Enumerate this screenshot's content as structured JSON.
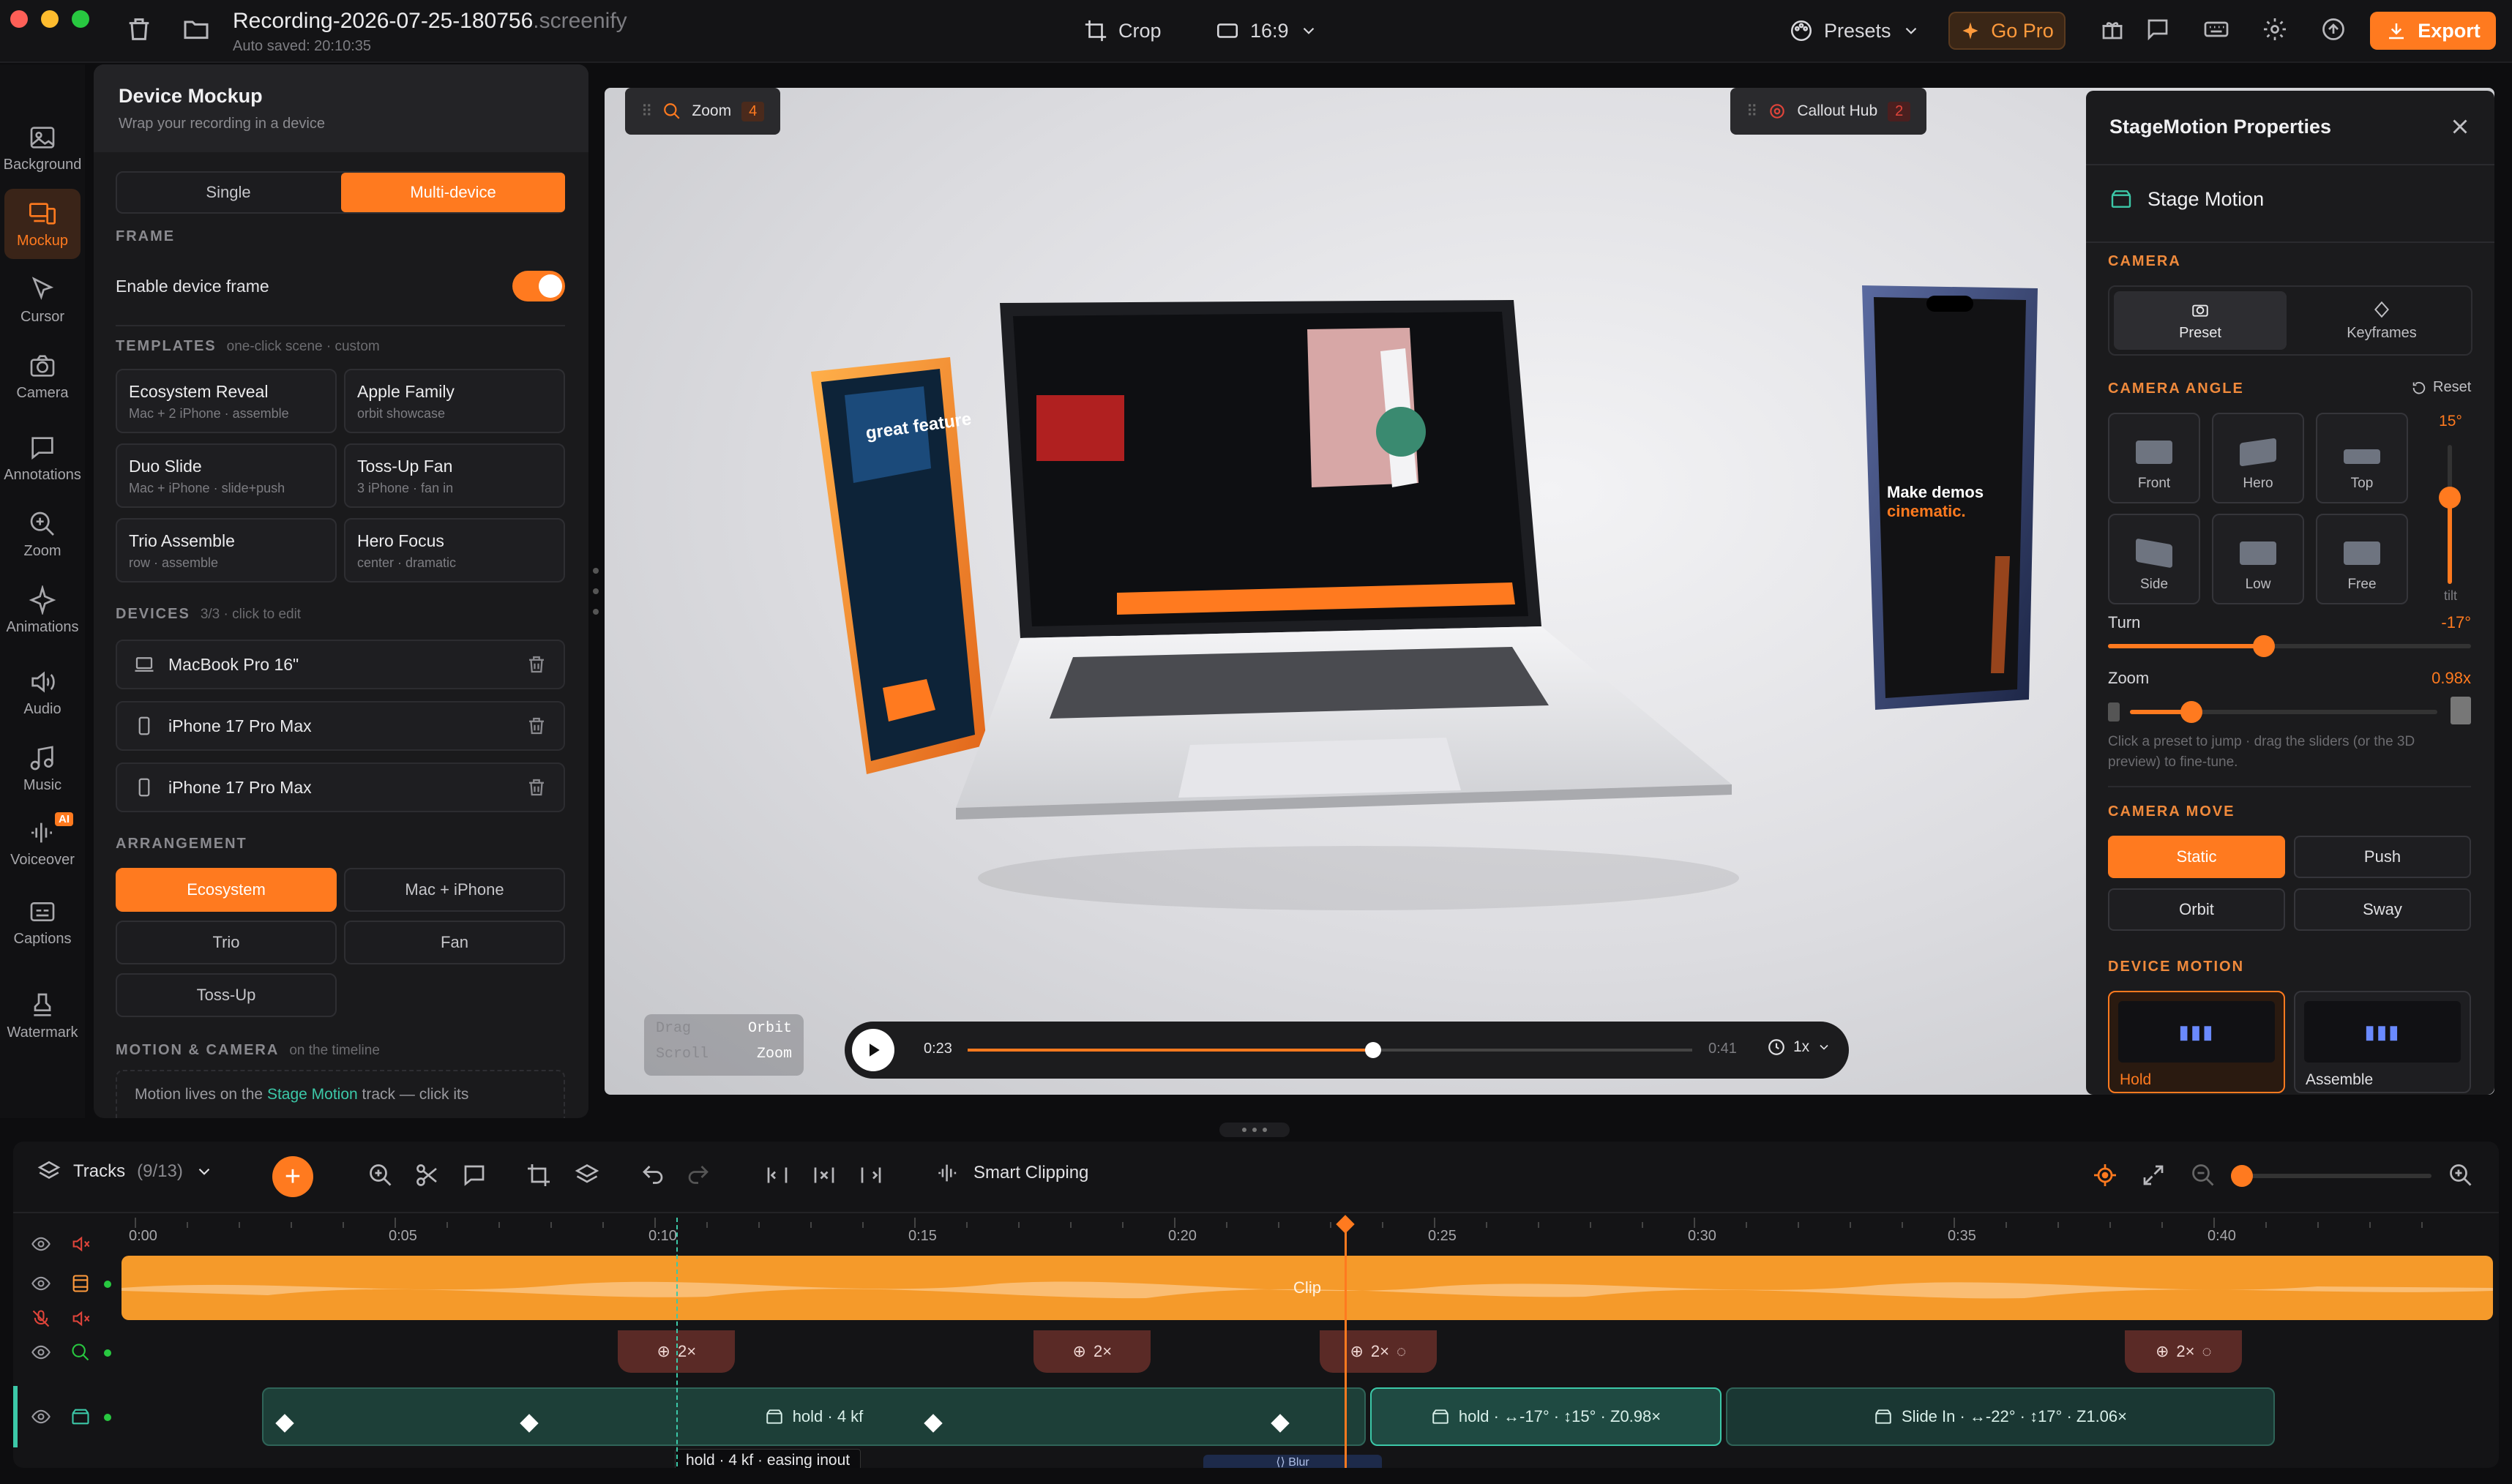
{
  "titlebar": {
    "file_name": "Recording-2026-07-25-180756",
    "file_ext": ".screenify",
    "autosave": "Auto saved: 20:10:35",
    "crop_label": "Crop",
    "ratio_label": "16:9",
    "presets_label": "Presets",
    "gopro_label": "Go Pro",
    "export_label": "Export"
  },
  "rail": [
    {
      "label": "Background",
      "icon": "image-icon"
    },
    {
      "label": "Mockup",
      "icon": "devices-icon",
      "active": true
    },
    {
      "label": "Cursor",
      "icon": "cursor-icon"
    },
    {
      "label": "Camera",
      "icon": "camera-icon"
    },
    {
      "label": "Annotations",
      "icon": "comment-icon"
    },
    {
      "label": "Zoom",
      "icon": "zoom-icon"
    },
    {
      "label": "Animations",
      "icon": "sparkle-icon"
    },
    {
      "label": "Audio",
      "icon": "speaker-icon"
    },
    {
      "label": "Music",
      "icon": "music-icon"
    },
    {
      "label": "Voiceover",
      "icon": "waveform-icon",
      "badge": "AI"
    },
    {
      "label": "Captions",
      "icon": "captions-icon"
    },
    {
      "label": "Watermark",
      "icon": "stamp-icon"
    }
  ],
  "panel": {
    "title": "Device Mockup",
    "subtitle": "Wrap your recording in a device",
    "mode_single": "Single",
    "mode_multi": "Multi-device",
    "frame_section": "FRAME",
    "enable_frame": "Enable device frame",
    "templates_section": "TEMPLATES",
    "templates_hint": "one-click scene · custom",
    "templates": [
      {
        "title": "Ecosystem Reveal",
        "sub": "Mac + 2 iPhone · assemble"
      },
      {
        "title": "Apple Family",
        "sub": "orbit showcase"
      },
      {
        "title": "Duo Slide",
        "sub": "Mac + iPhone · slide+push"
      },
      {
        "title": "Toss-Up Fan",
        "sub": "3 iPhone · fan in"
      },
      {
        "title": "Trio Assemble",
        "sub": "row · assemble"
      },
      {
        "title": "Hero Focus",
        "sub": "center · dramatic"
      }
    ],
    "devices_section": "DEVICES",
    "devices_hint": "3/3 · click to edit",
    "devices": [
      {
        "name": "MacBook Pro 16\"",
        "icon": "laptop-icon"
      },
      {
        "name": "iPhone 17 Pro Max",
        "icon": "phone-icon"
      },
      {
        "name": "iPhone 17 Pro Max",
        "icon": "phone-icon"
      }
    ],
    "arrangement_section": "ARRANGEMENT",
    "arrangements": [
      "Ecosystem",
      "Mac + iPhone",
      "Trio",
      "Fan",
      "Toss-Up"
    ],
    "motion_section": "MOTION & CAMERA",
    "motion_hint": "on the timeline",
    "motion_text_pre": "Motion lives on the",
    "motion_link": "Stage Motion",
    "motion_text_post": "track — click its"
  },
  "stage": {
    "zoom_chip": "Zoom",
    "zoom_count": "4",
    "callout_chip": "Callout Hub",
    "callout_count": "2",
    "hint_drag": "Drag",
    "hint_orbit": "Orbit",
    "hint_scroll": "Scroll",
    "hint_zoom": "Zoom",
    "time_current": "0:23",
    "time_total": "0:41",
    "progress": 0.56,
    "speed": "1x"
  },
  "props": {
    "title": "StageMotion Properties",
    "stage_motion": "Stage Motion",
    "camera_section": "CAMERA",
    "camera_preset": "Preset",
    "camera_keyframes": "Keyframes",
    "angle_section": "CAMERA ANGLE",
    "reset_label": "Reset",
    "angles": [
      "Front",
      "Hero",
      "Top",
      "Side",
      "Low",
      "Free"
    ],
    "tilt_value": "15°",
    "tilt_label": "tilt",
    "tilt_level": 0.62,
    "turn_label": "Turn",
    "turn_value": "-17°",
    "turn_level": 0.43,
    "zoom_label": "Zoom",
    "zoom_value": "0.98x",
    "zoom_level": 0.2,
    "hint": "Click a preset to jump · drag the sliders (or the 3D preview) to fine-tune.",
    "move_section": "CAMERA MOVE",
    "moves": [
      "Static",
      "Push",
      "Orbit",
      "Sway"
    ],
    "device_motion_section": "DEVICE MOTION",
    "device_motions": [
      "Hold",
      "Assemble"
    ]
  },
  "timeline": {
    "tracks_label": "Tracks",
    "tracks_count": "(9/13)",
    "smart_clipping": "Smart Clipping",
    "ticks": [
      "0:00",
      "0:05",
      "0:10",
      "0:15",
      "0:20",
      "0:25",
      "0:30",
      "0:35",
      "0:40"
    ],
    "playhead_time": 23.3,
    "clip_label": "Clip",
    "zoom_clips": [
      {
        "start": 9.3,
        "label": "2×"
      },
      {
        "start": 17.3,
        "label": "2×"
      },
      {
        "start": 22.8,
        "label": "2×"
      },
      {
        "start": 38.3,
        "label": "2×"
      }
    ],
    "kf_clips": [
      {
        "label": "hold · 4 kf"
      },
      {
        "label": "hold · ↔-17° · ↕15° · Z0.98×"
      },
      {
        "label": "Slide In · ↔-22° · ↕17° · Z1.06×"
      }
    ],
    "tooltip": "hold · 4 kf · easing inout",
    "blur_label": "Blur",
    "colors": {
      "accent": "#ff7a1f",
      "teal": "#1d3f38",
      "zoom": "#5a2a26"
    }
  }
}
